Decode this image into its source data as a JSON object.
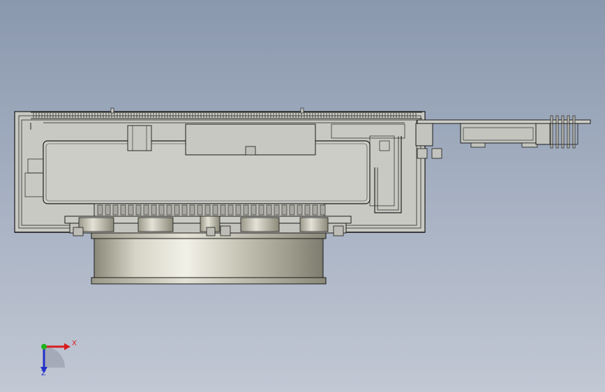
{
  "viewport": {
    "background_top": "#8a98ae",
    "background_bottom": "#c2c8d4"
  },
  "model": {
    "body_color": "#c8c8c2",
    "edge_color": "#1a1a1a",
    "cylinder_color": "#b8b6a8"
  },
  "triad": {
    "x_label": "X",
    "z_label": "Z",
    "x_color": "#d81e1e",
    "y_color": "#1fb31f",
    "z_color": "#2230c8"
  }
}
